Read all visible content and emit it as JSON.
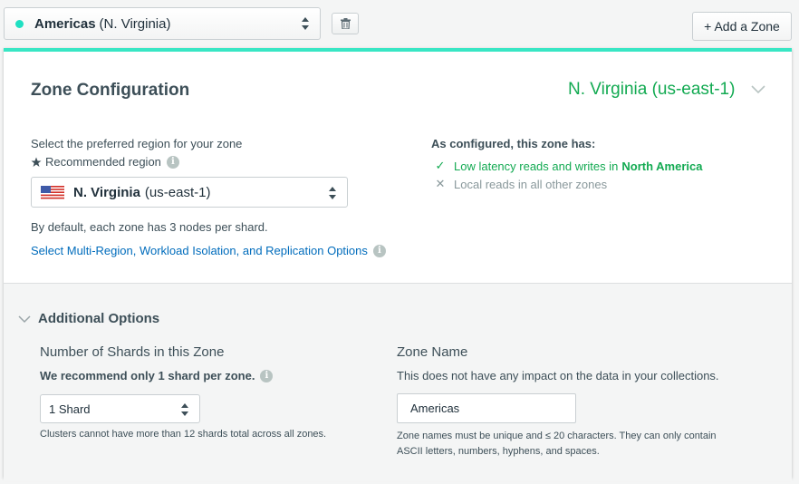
{
  "topbar": {
    "zone_name": "Americas",
    "zone_region": "(N. Virginia)",
    "add_zone_label": "+ Add a Zone"
  },
  "config": {
    "title": "Zone Configuration",
    "region_header": "N. Virginia (us-east-1)",
    "preferred_label": "Select the preferred region for your zone",
    "recommended_label": "Recommended region",
    "region_select": {
      "name": "N. Virginia",
      "code": "(us-east-1)"
    },
    "default_text": "By default, each zone has 3 nodes per shard.",
    "multi_region_link": "Select Multi-Region, Workload Isolation, and Replication Options",
    "as_configured_label": "As configured, this zone has:",
    "features": [
      {
        "text": "Low latency reads and writes in",
        "highlight": "North America",
        "status": "included"
      },
      {
        "text": "Local reads in all other zones",
        "highlight": "",
        "status": "excluded"
      }
    ]
  },
  "additional": {
    "title": "Additional Options",
    "shards": {
      "title": "Number of Shards in this Zone",
      "recommendation": "We recommend only 1 shard per zone.",
      "selected": "1 Shard",
      "note": "Clusters cannot have more than 12 shards total across all zones."
    },
    "zone_name": {
      "title": "Zone Name",
      "description": "This does not have any impact on the data in your collections.",
      "value": "Americas",
      "note": "Zone names must be unique and ≤ 20 characters. They can only contain ASCII letters, numbers, hyphens, and spaces."
    }
  },
  "colors": {
    "accent": "#38e6c4",
    "zone_dot": "#1fe0c2",
    "success": "#13aa52",
    "link": "#006cbc",
    "muted": "#89989b"
  },
  "icons": [
    "trash-icon",
    "updown-arrows-icon",
    "chevron-down-icon",
    "star-icon",
    "info-icon",
    "check-icon",
    "x-icon",
    "us-flag-icon"
  ]
}
